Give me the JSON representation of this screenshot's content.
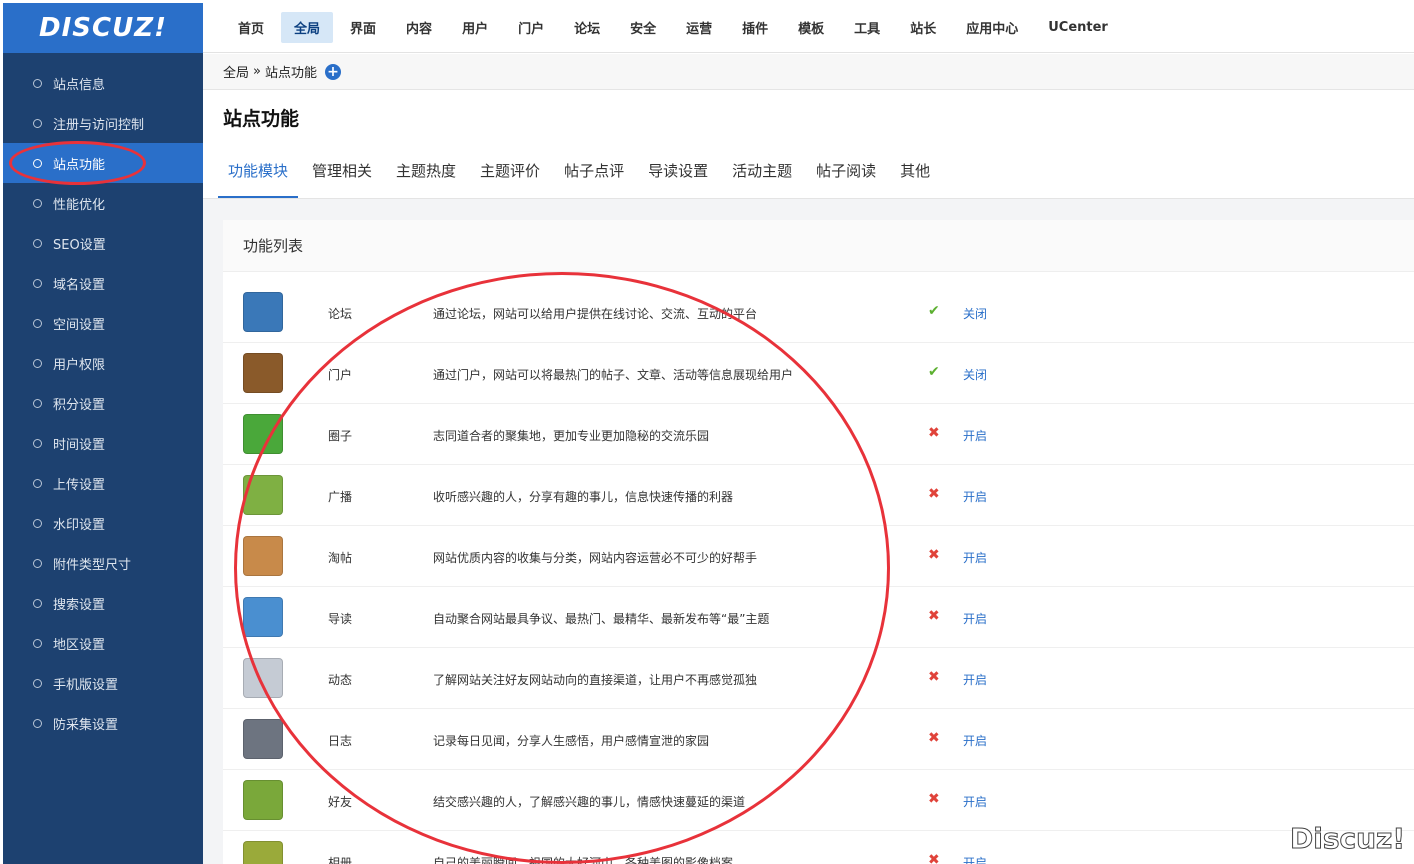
{
  "logo": "DISCUZ!",
  "sidebar": {
    "items": [
      {
        "label": "站点信息"
      },
      {
        "label": "注册与访问控制"
      },
      {
        "label": "站点功能"
      },
      {
        "label": "性能优化"
      },
      {
        "label": "SEO设置"
      },
      {
        "label": "域名设置"
      },
      {
        "label": "空间设置"
      },
      {
        "label": "用户权限"
      },
      {
        "label": "积分设置"
      },
      {
        "label": "时间设置"
      },
      {
        "label": "上传设置"
      },
      {
        "label": "水印设置"
      },
      {
        "label": "附件类型尺寸"
      },
      {
        "label": "搜索设置"
      },
      {
        "label": "地区设置"
      },
      {
        "label": "手机版设置"
      },
      {
        "label": "防采集设置"
      }
    ],
    "active_index": 2
  },
  "topnav": {
    "items": [
      "首页",
      "全局",
      "界面",
      "内容",
      "用户",
      "门户",
      "论坛",
      "安全",
      "运营",
      "插件",
      "模板",
      "工具",
      "站长",
      "应用中心",
      "UCenter"
    ],
    "active_index": 1
  },
  "breadcrumb": {
    "root": "全局",
    "separator": "»",
    "current": "站点功能",
    "add_icon": "plus-circle-icon"
  },
  "page_title": "站点功能",
  "tabs": {
    "items": [
      "功能模块",
      "管理相关",
      "主题热度",
      "主题评价",
      "帖子点评",
      "导读设置",
      "活动主题",
      "帖子阅读",
      "其他"
    ],
    "active_index": 0
  },
  "panel": {
    "title": "功能列表",
    "rows": [
      {
        "name": "论坛",
        "desc": "通过论坛，网站可以给用户提供在线讨论、交流、互动的平台",
        "enabled": true,
        "action": "关闭",
        "icon": "forum-icon",
        "color": "#3a78b8"
      },
      {
        "name": "门户",
        "desc": "通过门户，网站可以将最热门的帖子、文章、活动等信息展现给用户",
        "enabled": true,
        "action": "关闭",
        "icon": "portal-icon",
        "color": "#8a5a2a"
      },
      {
        "name": "圈子",
        "desc": "志同道合者的聚集地，更加专业更加隐秘的交流乐园",
        "enabled": false,
        "action": "开启",
        "icon": "group-icon",
        "color": "#4aa83a"
      },
      {
        "name": "广播",
        "desc": "收听感兴趣的人，分享有趣的事儿，信息快速传播的利器",
        "enabled": false,
        "action": "开启",
        "icon": "broadcast-icon",
        "color": "#7fb043"
      },
      {
        "name": "淘帖",
        "desc": "网站优质内容的收集与分类，网站内容运营必不可少的好帮手",
        "enabled": false,
        "action": "开启",
        "icon": "collection-icon",
        "color": "#c88a4a"
      },
      {
        "name": "导读",
        "desc": "自动聚合网站最具争议、最热门、最精华、最新发布等“最”主题",
        "enabled": false,
        "action": "开启",
        "icon": "guide-icon",
        "color": "#4a8fd0"
      },
      {
        "name": "动态",
        "desc": "了解网站关注好友网站动向的直接渠道，让用户不再感觉孤独",
        "enabled": false,
        "action": "开启",
        "icon": "feed-icon",
        "color": "#c5cbd4"
      },
      {
        "name": "日志",
        "desc": "记录每日见闻，分享人生感悟，用户感情宣泄的家园",
        "enabled": false,
        "action": "开启",
        "icon": "blog-icon",
        "color": "#6d7480"
      },
      {
        "name": "好友",
        "desc": "结交感兴趣的人，了解感兴趣的事儿，情感快速蔓延的渠道",
        "enabled": false,
        "action": "开启",
        "icon": "friends-icon",
        "color": "#7aa83a"
      },
      {
        "name": "相册",
        "desc": "自己的美丽瞬间、祖国的大好河山，各种美图的影像档案",
        "enabled": false,
        "action": "开启",
        "icon": "album-icon",
        "color": "#9aaa3a"
      }
    ],
    "status_on_glyph": "✔",
    "status_off_glyph": "✖"
  },
  "watermark": "Discuz!"
}
